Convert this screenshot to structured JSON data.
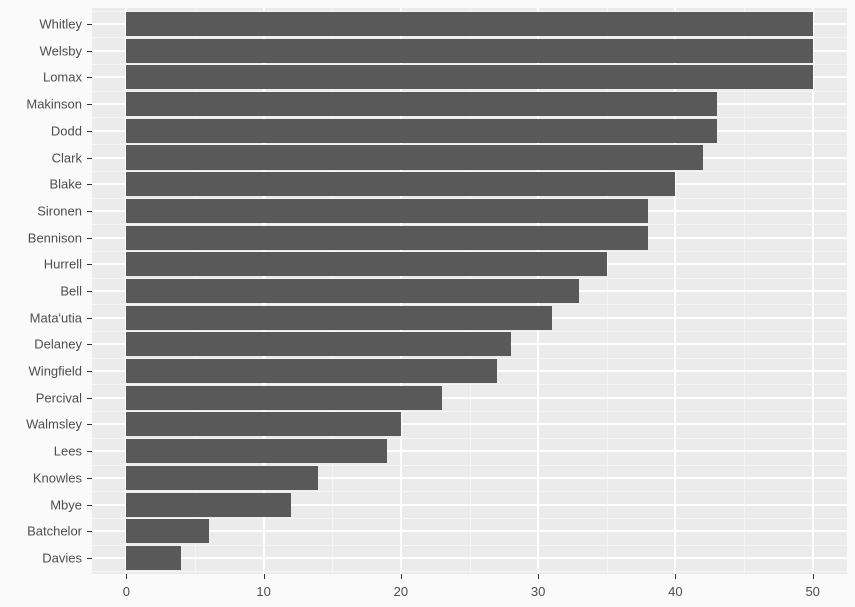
{
  "chart_data": {
    "type": "bar",
    "orientation": "horizontal",
    "categories": [
      "Whitley",
      "Welsby",
      "Lomax",
      "Makinson",
      "Dodd",
      "Clark",
      "Blake",
      "Sironen",
      "Bennison",
      "Hurrell",
      "Bell",
      "Mata'utia",
      "Delaney",
      "Wingfield",
      "Percival",
      "Walmsley",
      "Lees",
      "Knowles",
      "Mbye",
      "Batchelor",
      "Davies"
    ],
    "values": [
      50,
      50,
      50,
      43,
      43,
      42,
      40,
      38,
      38,
      35,
      33,
      31,
      28,
      27,
      23,
      20,
      19,
      14,
      12,
      6,
      4
    ],
    "xlabel": "",
    "ylabel": "",
    "xlim": [
      0,
      50
    ],
    "x_ticks": [
      0,
      10,
      20,
      30,
      40,
      50
    ],
    "bar_fill": "#595959",
    "panel_bg": "#ebebeb"
  }
}
